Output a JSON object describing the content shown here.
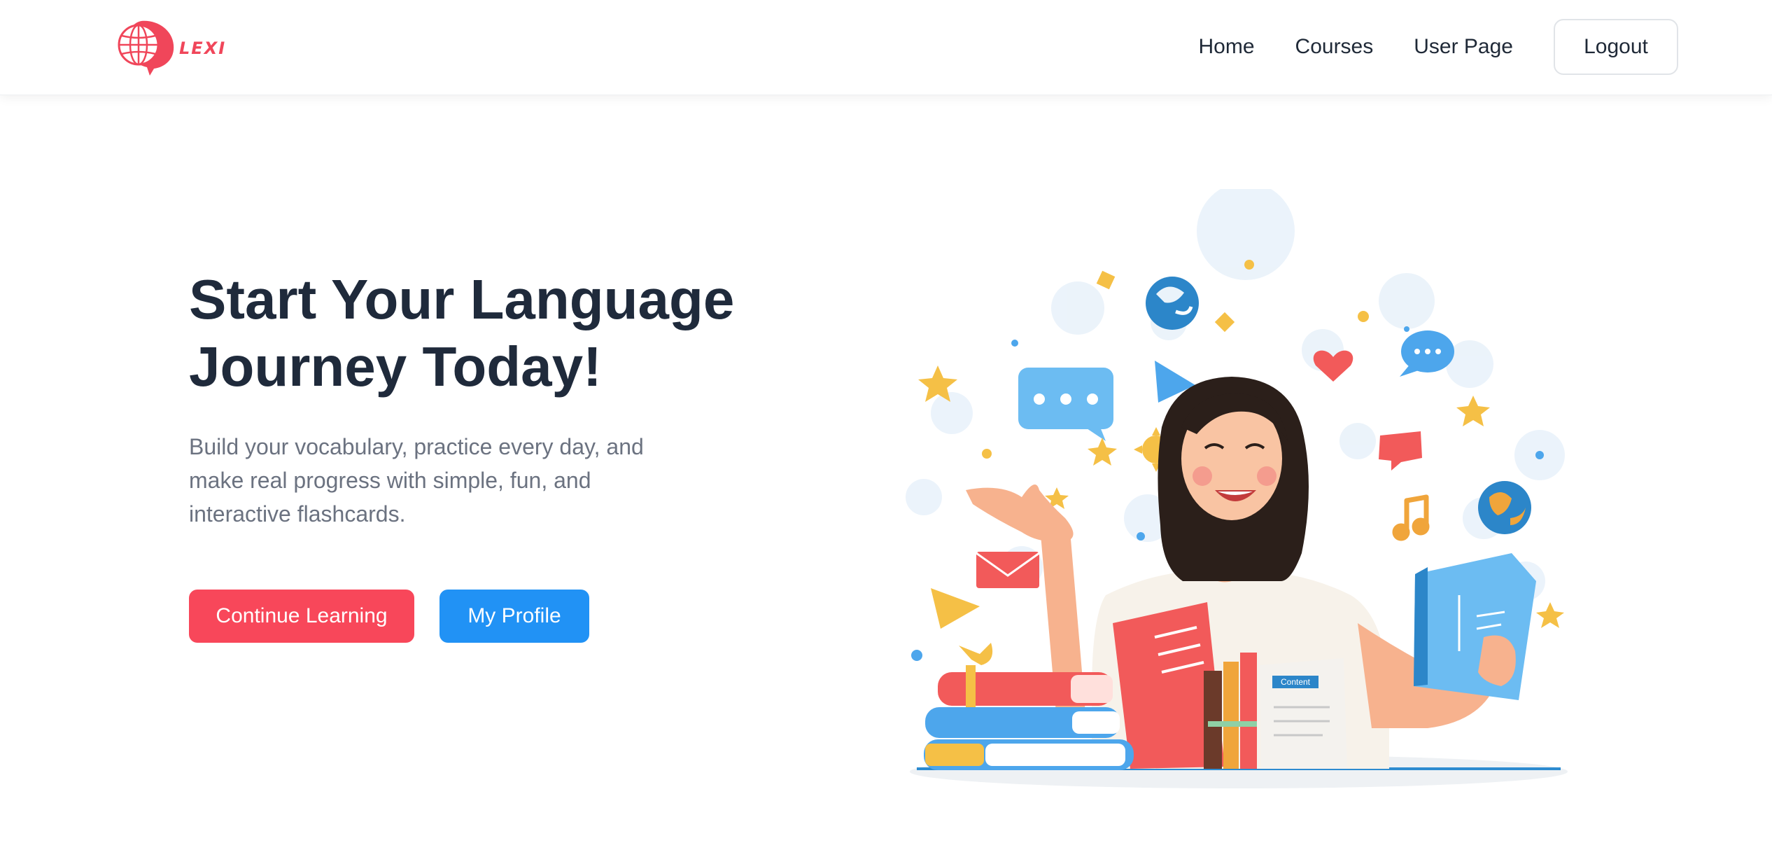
{
  "brand": {
    "name": "LEXI",
    "color": "#f0465a",
    "icon": "globe-speech-bubble-icon"
  },
  "nav": {
    "links": [
      {
        "label": "Home"
      },
      {
        "label": "Courses"
      },
      {
        "label": "User Page"
      }
    ],
    "logout_label": "Logout"
  },
  "hero": {
    "title_line1": "Start Your Language",
    "title_line2": "Journey Today!",
    "subtitle_line1": "Build your vocabulary, practice every day, and",
    "subtitle_line2": "make real progress with simple, fun, and",
    "subtitle_line3": "interactive flashcards.",
    "primary_button": "Continue Learning",
    "secondary_button": "My Profile",
    "colors": {
      "primary": "#f8475a",
      "secondary": "#2192f5",
      "title": "#1f2a3b",
      "subtitle": "#6b7280"
    }
  },
  "illustration": {
    "book_label": "Content",
    "icons": [
      "chat-bubble-icon",
      "globe-icon",
      "heart-icon",
      "envelope-icon",
      "music-note-icon",
      "paper-plane-icon",
      "star-icon",
      "book-icon"
    ]
  }
}
